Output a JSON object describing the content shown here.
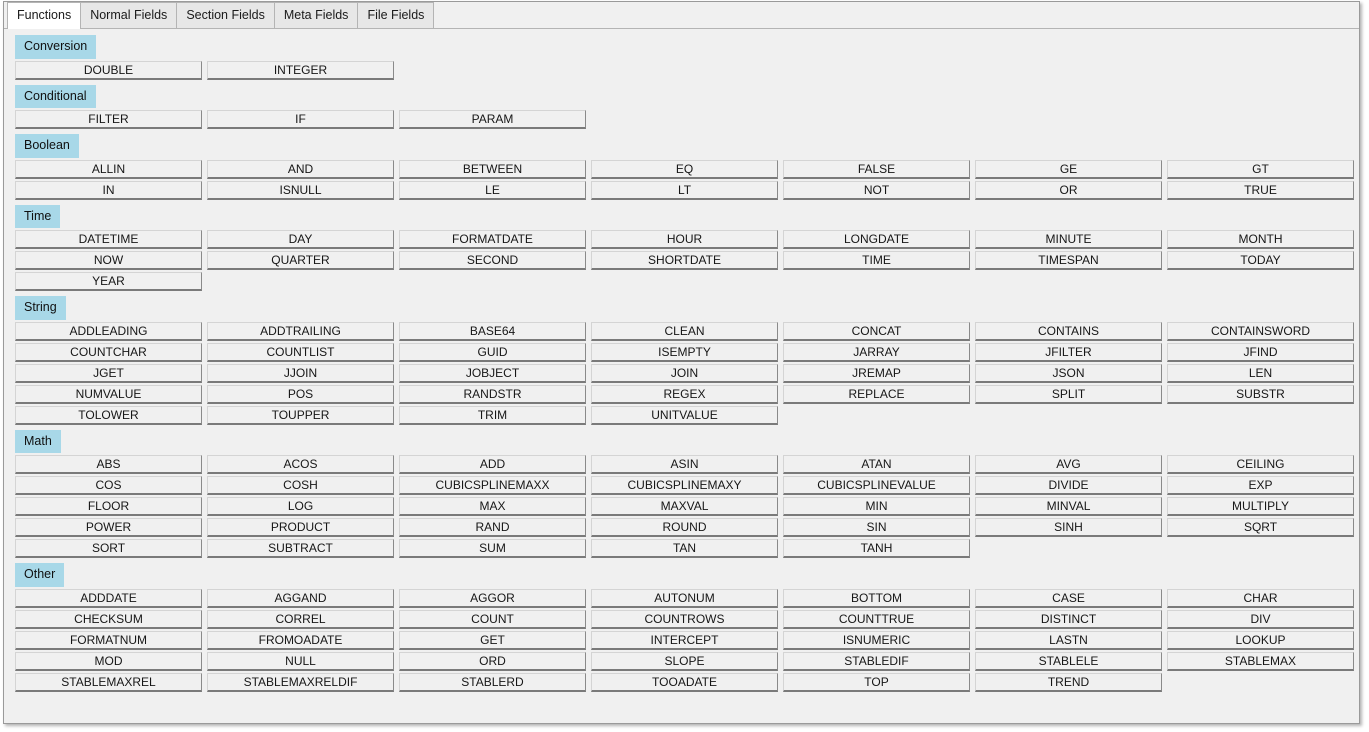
{
  "window": {
    "title": "Functions"
  },
  "tabs": [
    {
      "label": "Functions",
      "active": true
    },
    {
      "label": "Normal Fields",
      "active": false
    },
    {
      "label": "Section Fields",
      "active": false
    },
    {
      "label": "Meta Fields",
      "active": false
    },
    {
      "label": "File Fields",
      "active": false
    }
  ],
  "colors": {
    "section_header_bg": "#a8d8e8",
    "panel_bg": "#f0f0f0",
    "button_bg": "#f0f0f0",
    "active_tab_bg": "#ffffff",
    "inactive_tab_bg": "#e7e7e7"
  },
  "columns_per_row": 7,
  "sections": [
    {
      "name": "Conversion",
      "functions": [
        "DOUBLE",
        "INTEGER"
      ]
    },
    {
      "name": "Conditional",
      "functions": [
        "FILTER",
        "IF",
        "PARAM"
      ]
    },
    {
      "name": "Boolean",
      "functions": [
        "ALLIN",
        "AND",
        "BETWEEN",
        "EQ",
        "FALSE",
        "GE",
        "GT",
        "IN",
        "ISNULL",
        "LE",
        "LT",
        "NOT",
        "OR",
        "TRUE"
      ]
    },
    {
      "name": "Time",
      "functions": [
        "DATETIME",
        "DAY",
        "FORMATDATE",
        "HOUR",
        "LONGDATE",
        "MINUTE",
        "MONTH",
        "NOW",
        "QUARTER",
        "SECOND",
        "SHORTDATE",
        "TIME",
        "TIMESPAN",
        "TODAY",
        "YEAR"
      ]
    },
    {
      "name": "String",
      "functions": [
        "ADDLEADING",
        "ADDTRAILING",
        "BASE64",
        "CLEAN",
        "CONCAT",
        "CONTAINS",
        "CONTAINSWORD",
        "COUNTCHAR",
        "COUNTLIST",
        "GUID",
        "ISEMPTY",
        "JARRAY",
        "JFILTER",
        "JFIND",
        "JGET",
        "JJOIN",
        "JOBJECT",
        "JOIN",
        "JREMAP",
        "JSON",
        "LEN",
        "NUMVALUE",
        "POS",
        "RANDSTR",
        "REGEX",
        "REPLACE",
        "SPLIT",
        "SUBSTR",
        "TOLOWER",
        "TOUPPER",
        "TRIM",
        "UNITVALUE"
      ]
    },
    {
      "name": "Math",
      "functions": [
        "ABS",
        "ACOS",
        "ADD",
        "ASIN",
        "ATAN",
        "AVG",
        "CEILING",
        "COS",
        "COSH",
        "CUBICSPLINEMAXX",
        "CUBICSPLINEMAXY",
        "CUBICSPLINEVALUE",
        "DIVIDE",
        "EXP",
        "FLOOR",
        "LOG",
        "MAX",
        "MAXVAL",
        "MIN",
        "MINVAL",
        "MULTIPLY",
        "POWER",
        "PRODUCT",
        "RAND",
        "ROUND",
        "SIN",
        "SINH",
        "SQRT",
        "SORT",
        "SUBTRACT",
        "SUM",
        "TAN",
        "TANH"
      ]
    },
    {
      "name": "Other",
      "functions": [
        "ADDDATE",
        "AGGAND",
        "AGGOR",
        "AUTONUM",
        "BOTTOM",
        "CASE",
        "CHAR",
        "CHECKSUM",
        "CORREL",
        "COUNT",
        "COUNTROWS",
        "COUNTTRUE",
        "DISTINCT",
        "DIV",
        "FORMATNUM",
        "FROMOADATE",
        "GET",
        "INTERCEPT",
        "ISNUMERIC",
        "LASTN",
        "LOOKUP",
        "MOD",
        "NULL",
        "ORD",
        "SLOPE",
        "STABLEDIF",
        "STABLELE",
        "STABLEMAX",
        "STABLEMAXREL",
        "STABLEMAXRELDIF",
        "STABLERD",
        "TOOADATE",
        "TOP",
        "TREND"
      ]
    }
  ]
}
